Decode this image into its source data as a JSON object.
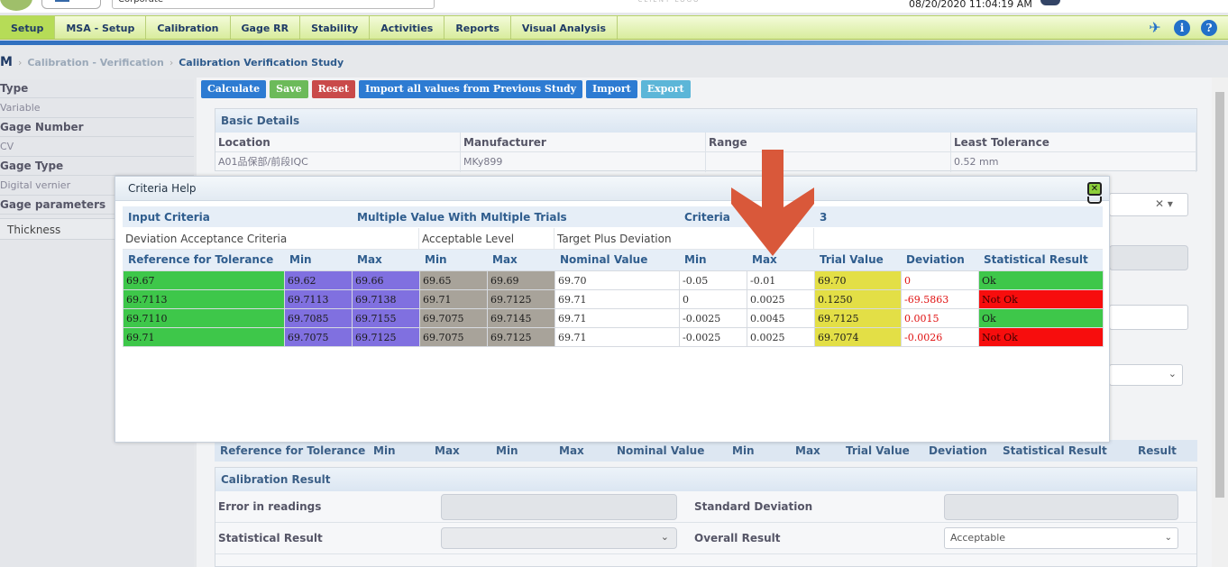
{
  "header": {
    "corporate": "Corporate",
    "client_logo": "CLIENT LOGO",
    "datetime": "08/20/2020 11:04:19 AM"
  },
  "nav": {
    "tabs": [
      "Setup",
      "MSA - Setup",
      "Calibration",
      "Gage RR",
      "Stability",
      "Activities",
      "Reports",
      "Visual Analysis"
    ],
    "active": "Setup",
    "icons": [
      "pin-icon",
      "info-icon",
      "help-icon"
    ],
    "info_glyph": "i",
    "help_glyph": "?"
  },
  "breadcrumb": {
    "home": "M",
    "level1": "Calibration - Verification",
    "current": "Calibration Verification Study"
  },
  "sidebar": {
    "type_label": "Type",
    "type_value": "Variable",
    "gage_number_label": "Gage Number",
    "gage_number_value": "CV",
    "gage_type_label": "Gage Type",
    "gage_type_value": "Digital vernier",
    "gage_params_label": "Gage parameters",
    "param_item": "Thickness"
  },
  "toolbar": {
    "calculate": "Calculate",
    "save": "Save",
    "reset": "Reset",
    "import_prev": "Import all values from Previous Study",
    "import": "Import",
    "export": "Export"
  },
  "basic": {
    "title": "Basic Details",
    "headers": [
      "Location",
      "Manufacturer",
      "Range",
      "Least Tolerance"
    ],
    "values": [
      "A01品保部/前段IQC",
      "MKy899",
      "",
      "0.52 mm"
    ]
  },
  "background_columns": [
    "Reference for Tolerance",
    "Min",
    "Max",
    "Min",
    "Max",
    "Nominal Value",
    "Min",
    "Max",
    "Trial Value",
    "Deviation",
    "Statistical Result",
    "Result"
  ],
  "calibration_result": {
    "title": "Calibration Result",
    "error_label": "Error in readings",
    "std_label": "Standard Deviation",
    "stat_label": "Statistical Result",
    "overall_label": "Overall Result",
    "overall_value": "Acceptable"
  },
  "modal": {
    "title": "Criteria Help",
    "input_criteria": "Input Criteria",
    "multiple": "Multiple Value With Multiple Trials",
    "criteria_label": "Criteria",
    "criteria_value": "3",
    "deviation_acceptance": "Deviation Acceptance Criteria",
    "acceptable_level": "Acceptable Level",
    "target_plus_deviation": "Target Plus Deviation",
    "columns": [
      "Reference for Tolerance",
      "Min",
      "Max",
      "Min",
      "Max",
      "Nominal Value",
      "Min",
      "Max",
      "Trial Value",
      "Deviation",
      "Statistical Result"
    ],
    "rows": [
      [
        "69.67",
        "69.62",
        "69.66",
        "69.65",
        "69.69",
        "69.70",
        "-0.05",
        "-0.01",
        "69.70",
        "0",
        "Ok"
      ],
      [
        "69.7113",
        "69.7113",
        "69.7138",
        "69.71",
        "69.7125",
        "69.71",
        "0",
        "0.0025",
        "0.1250",
        "-69.5863",
        "Not Ok"
      ],
      [
        "69.7110",
        "69.7085",
        "69.7155",
        "69.7075",
        "69.7145",
        "69.71",
        "-0.0025",
        "0.0045",
        "69.7125",
        "0.0015",
        "Ok"
      ],
      [
        "69.71",
        "69.7075",
        "69.7125",
        "69.7075",
        "69.7125",
        "69.71",
        "-0.0025",
        "0.0025",
        "69.7074",
        "-0.0026",
        "Not Ok"
      ]
    ]
  },
  "colors": {
    "green": "#3ec74a",
    "purple": "#8070e0",
    "gray": "#a8a39a",
    "yellow": "#e3df46",
    "red": "#f70d0d",
    "arrow": "#d9583a"
  }
}
